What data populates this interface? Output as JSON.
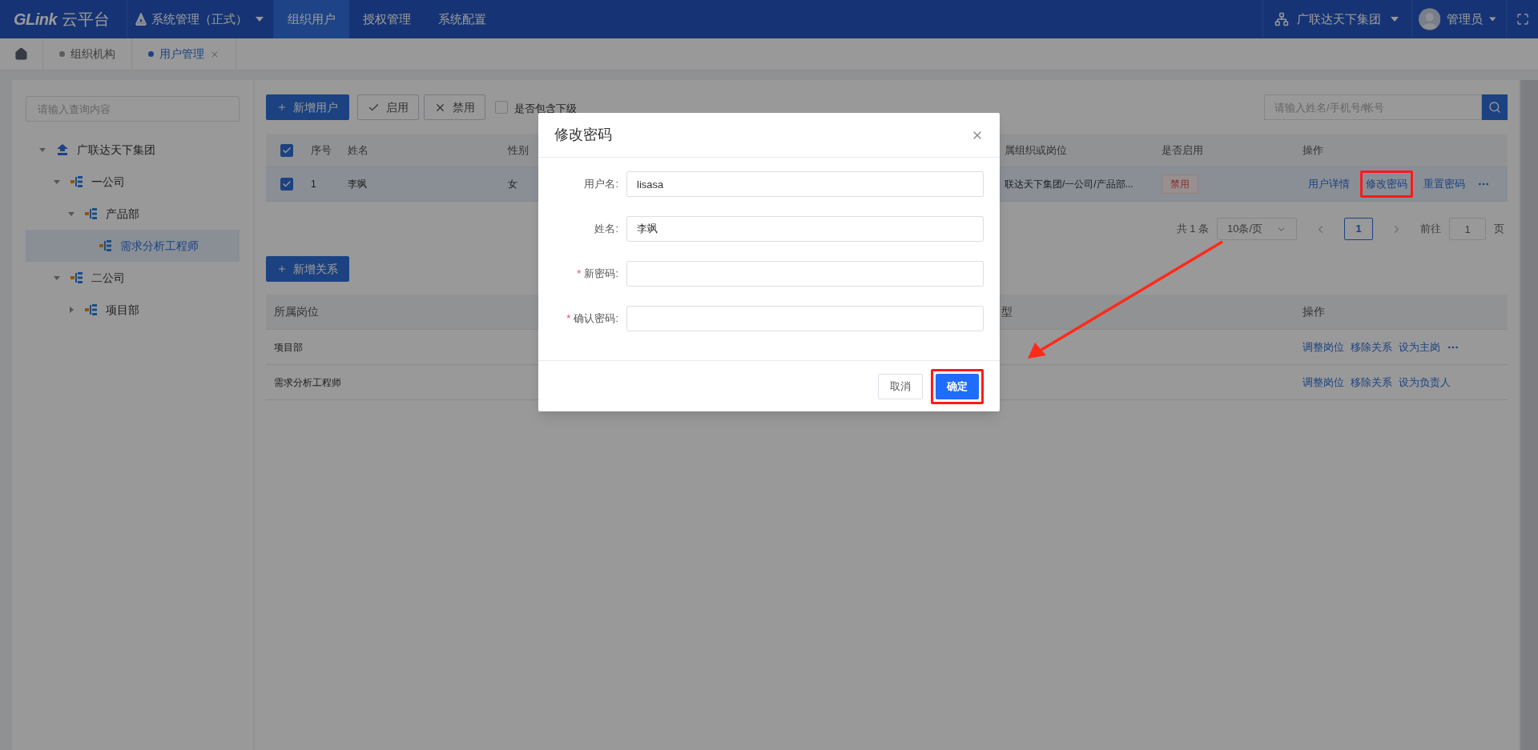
{
  "topbar": {
    "logo": "GLink",
    "logo_suffix": "云平台",
    "system": "系统管理（正式）",
    "nav": [
      {
        "label": "组织用户",
        "selected": true
      },
      {
        "label": "授权管理",
        "selected": false
      },
      {
        "label": "系统配置",
        "selected": false
      }
    ],
    "org": "广联达天下集团",
    "user": "管理员"
  },
  "tabs": [
    {
      "label": "组织机构",
      "selected": false,
      "closable": false
    },
    {
      "label": "用户管理",
      "selected": true,
      "closable": true
    }
  ],
  "tree": {
    "placeholder": "请输入查询内容",
    "items": [
      {
        "label": "广联达天下集团",
        "kind": "root",
        "expanded": true,
        "selected": false,
        "children": [
          {
            "label": "一公司",
            "kind": "org",
            "expanded": true,
            "selected": false,
            "children": [
              {
                "label": "产品部",
                "kind": "org",
                "expanded": true,
                "selected": false,
                "children": [
                  {
                    "label": "需求分析工程师",
                    "kind": "org",
                    "selected": true
                  }
                ]
              }
            ]
          },
          {
            "label": "二公司",
            "kind": "org",
            "expanded": true,
            "selected": false,
            "children": [
              {
                "label": "项目部",
                "kind": "org",
                "expanded": false,
                "selected": false
              }
            ]
          }
        ]
      }
    ]
  },
  "toolbar": {
    "buttons": [
      {
        "label": "新增用户",
        "kind": "add"
      },
      {
        "label": "启用",
        "kind": "check"
      },
      {
        "label": "禁用",
        "kind": "cross"
      }
    ],
    "include_sub": {
      "label": "是否包含下级",
      "checked": false
    },
    "search_placeholder": "请输入姓名/手机号/帐号"
  },
  "users_table": {
    "select_all_checked": true,
    "columns": [
      "序号",
      "姓名",
      "性别",
      "属组织或岗位",
      "是否启用",
      "操作"
    ],
    "rows": [
      {
        "checked": true,
        "cells": [
          "1",
          "李飒",
          "女",
          "联达天下集团/一公司/产品部..."
        ],
        "status": "禁用",
        "enabled": false,
        "actions": [
          {
            "label": "用户详情",
            "highlighted": false
          },
          {
            "label": "修改密码",
            "highlighted": true
          },
          {
            "label": "重置密码",
            "highlighted": false
          }
        ],
        "more": true
      }
    ]
  },
  "pagination": {
    "total": "共 1 条",
    "page_size": "10条/页",
    "current": "1",
    "goto_label": "前往",
    "goto_value": "1",
    "page_suffix": "页"
  },
  "relations": {
    "add_button": "新增关系",
    "columns": [
      "所属岗位",
      "型",
      "操作"
    ],
    "rows": [
      {
        "post": "项目部",
        "actions": [
          "调整岗位",
          "移除关系",
          "设为主岗"
        ],
        "more": true
      },
      {
        "post": "需求分析工程师",
        "actions": [
          "调整岗位",
          "移除关系",
          "设为负责人"
        ],
        "more": false
      }
    ]
  },
  "dialog": {
    "title": "修改密码",
    "fields": [
      {
        "label": "用户名:",
        "value": "lisasa"
      },
      {
        "label": "姓名:",
        "value": "李飒"
      },
      {
        "required_mark": "*",
        "label": "新密码:"
      },
      {
        "required_mark": "*",
        "label": "确认密码:"
      }
    ],
    "buttons": [
      {
        "label": "取消",
        "kind": "default",
        "highlighted": false
      },
      {
        "label": "确定",
        "kind": "primary",
        "highlighted": true
      }
    ]
  }
}
